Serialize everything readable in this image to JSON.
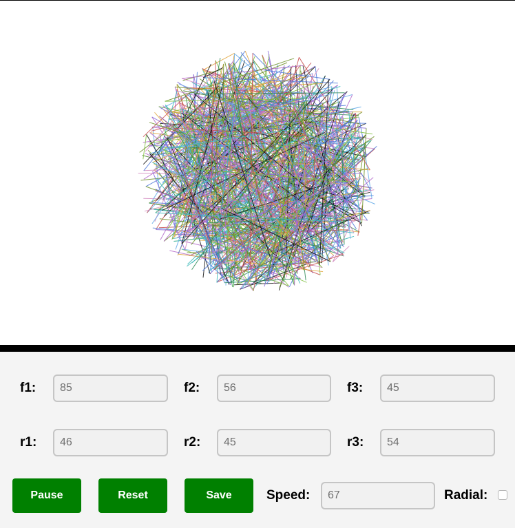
{
  "params": {
    "f1": {
      "label": "f1:",
      "value": "85"
    },
    "f2": {
      "label": "f2:",
      "value": "56"
    },
    "f3": {
      "label": "f3:",
      "value": "45"
    },
    "r1": {
      "label": "r1:",
      "value": "46"
    },
    "r2": {
      "label": "r2:",
      "value": "45"
    },
    "r3": {
      "label": "r3:",
      "value": "54"
    }
  },
  "buttons": {
    "pause": "Pause",
    "reset": "Reset",
    "save": "Save"
  },
  "speed": {
    "label": "Speed:",
    "value": "67"
  },
  "radial": {
    "label": "Radial:",
    "checked": false
  },
  "colors": {
    "button_bg": "#008000",
    "palette": [
      "#4d79d9",
      "#2e8b57",
      "#b267c9",
      "#e0a33a",
      "#3cb8b8",
      "#c94f4f",
      "#7fbf3f",
      "#111111",
      "#8a6ad8",
      "#5fa8e8",
      "#d28ac0",
      "#6b8e23"
    ]
  }
}
